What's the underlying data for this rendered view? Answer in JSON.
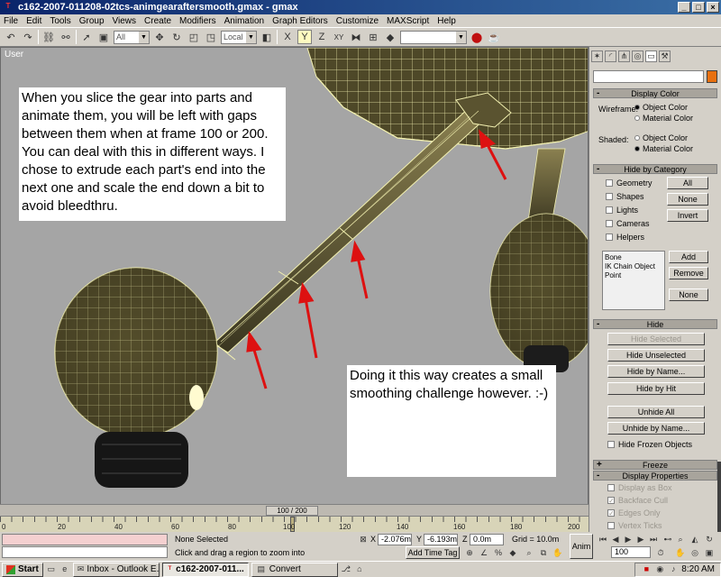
{
  "window": {
    "title": "c162-2007-011208-02tcs-animgearaftersmooth.gmax - gmax",
    "app_icon": "gmax-icon",
    "minimize": "_",
    "maximize": "□",
    "close": "×"
  },
  "menu": [
    "File",
    "Edit",
    "Tools",
    "Group",
    "Views",
    "Create",
    "Modifiers",
    "Animation",
    "Graph Editors",
    "Customize",
    "MAXScript",
    "Help"
  ],
  "toolbar": {
    "selection_filter": "All",
    "coord_system": "Local"
  },
  "viewport": {
    "label": "User",
    "note_top": "When you slice the gear into parts and animate them, you will be left with gaps between them when at frame 100 or 200.  You can deal with this in different ways.  I chose to extrude each part's end into the next one and scale the end down a bit to avoid bleedthru.",
    "note_bottom": "Doing it this way creates a small smoothing challenge however. :-)",
    "background_color": "#a5a5a5"
  },
  "command_panel": {
    "display_color": {
      "title": "Display Color",
      "wireframe_label": "Wireframe:",
      "shaded_label": "Shaded:",
      "object_color": "Object Color",
      "material_color": "Material Color"
    },
    "hide_by_category": {
      "title": "Hide by Category",
      "checks": [
        "Geometry",
        "Shapes",
        "Lights",
        "Cameras",
        "Helpers"
      ],
      "all": "All",
      "none": "None",
      "invert": "Invert",
      "list": [
        "Bone",
        "IK Chain Object",
        "Point"
      ],
      "add": "Add",
      "remove": "Remove",
      "list_none": "None"
    },
    "hide": {
      "title": "Hide",
      "hide_selected": "Hide Selected",
      "hide_unselected": "Hide Unselected",
      "hide_by_name": "Hide by Name...",
      "hide_by_hit": "Hide by Hit",
      "unhide_all": "Unhide All",
      "unhide_by_name": "Unhide by Name...",
      "hide_frozen": "Hide Frozen Objects"
    },
    "freeze": {
      "title": "Freeze",
      "sign": "+"
    },
    "display_properties": {
      "title": "Display Properties",
      "sign": "-",
      "items": [
        "Display as Box",
        "Backface Cull",
        "Edges Only",
        "Vertex Ticks"
      ]
    }
  },
  "timeline": {
    "slider_label": "100 / 200",
    "ticks": [
      "0",
      "20",
      "40",
      "60",
      "80",
      "100",
      "120",
      "140",
      "160",
      "180",
      "200"
    ]
  },
  "status": {
    "none_selected": "None Selected",
    "prompt": "Click and drag a region to zoom into",
    "x_label": "X",
    "x_value": "-2.076m",
    "y_label": "Y",
    "y_value": "-6.193m",
    "z_label": "Z",
    "z_value": "0.0m",
    "grid": "Grid = 10.0m",
    "add_time_tag": "Add Time Tag",
    "anim": "Anim",
    "frame": "100"
  },
  "taskbar": {
    "start": "Start",
    "tasks": [
      "Inbox - Outlook E...",
      "c162-2007-011...",
      "Convert"
    ],
    "clock": "8:20 AM"
  },
  "colors": {
    "wire": "#f2f0b0",
    "mesh": "#4a4426",
    "arrow": "#dd1111",
    "highlight": "#fffbc0",
    "object_color_swatch": "#e87010"
  }
}
